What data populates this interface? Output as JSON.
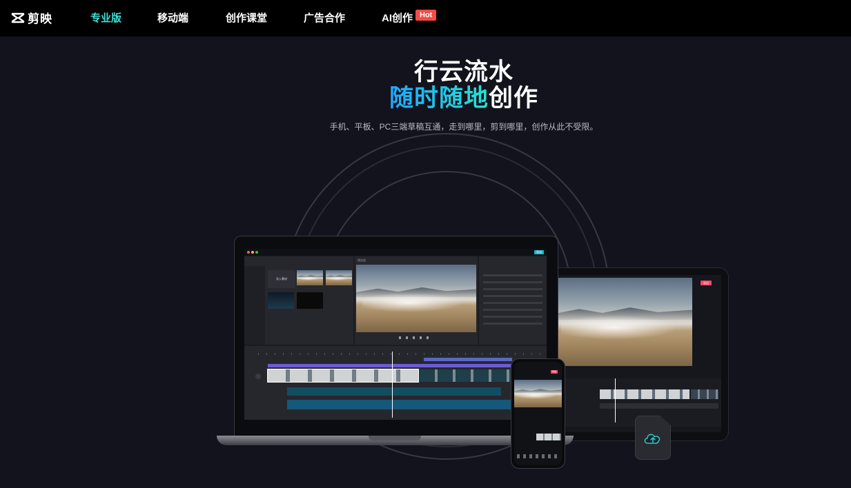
{
  "nav": {
    "logo_text": "剪映",
    "items": [
      {
        "label": "专业版",
        "active": true
      },
      {
        "label": "移动端"
      },
      {
        "label": "创作课堂"
      },
      {
        "label": "广告合作"
      },
      {
        "label": "AI创作"
      }
    ],
    "hot_badge": "Hot"
  },
  "hero": {
    "line1": "行云流水",
    "line2_highlight": "随时随地",
    "line2_rest": "创作",
    "subtitle": "手机、平板、PC三端草稿互通，走到哪里，剪到哪里，创作从此不受限。"
  },
  "colors": {
    "accent": "#3ee0d6",
    "gradient_start": "#1fa6ff",
    "gradient_end": "#26e3d1",
    "hot": "#f54a45",
    "background": "#12131d"
  },
  "devices": {
    "laptop_screen": {
      "player_label": "播放器",
      "import_label": "导入素材",
      "export_label": "导出"
    },
    "tablet_screen": {
      "export_label": "导出"
    },
    "phone_screen": {
      "export_label": "导出"
    },
    "cloud_icon": "cloud-upload-icon"
  }
}
